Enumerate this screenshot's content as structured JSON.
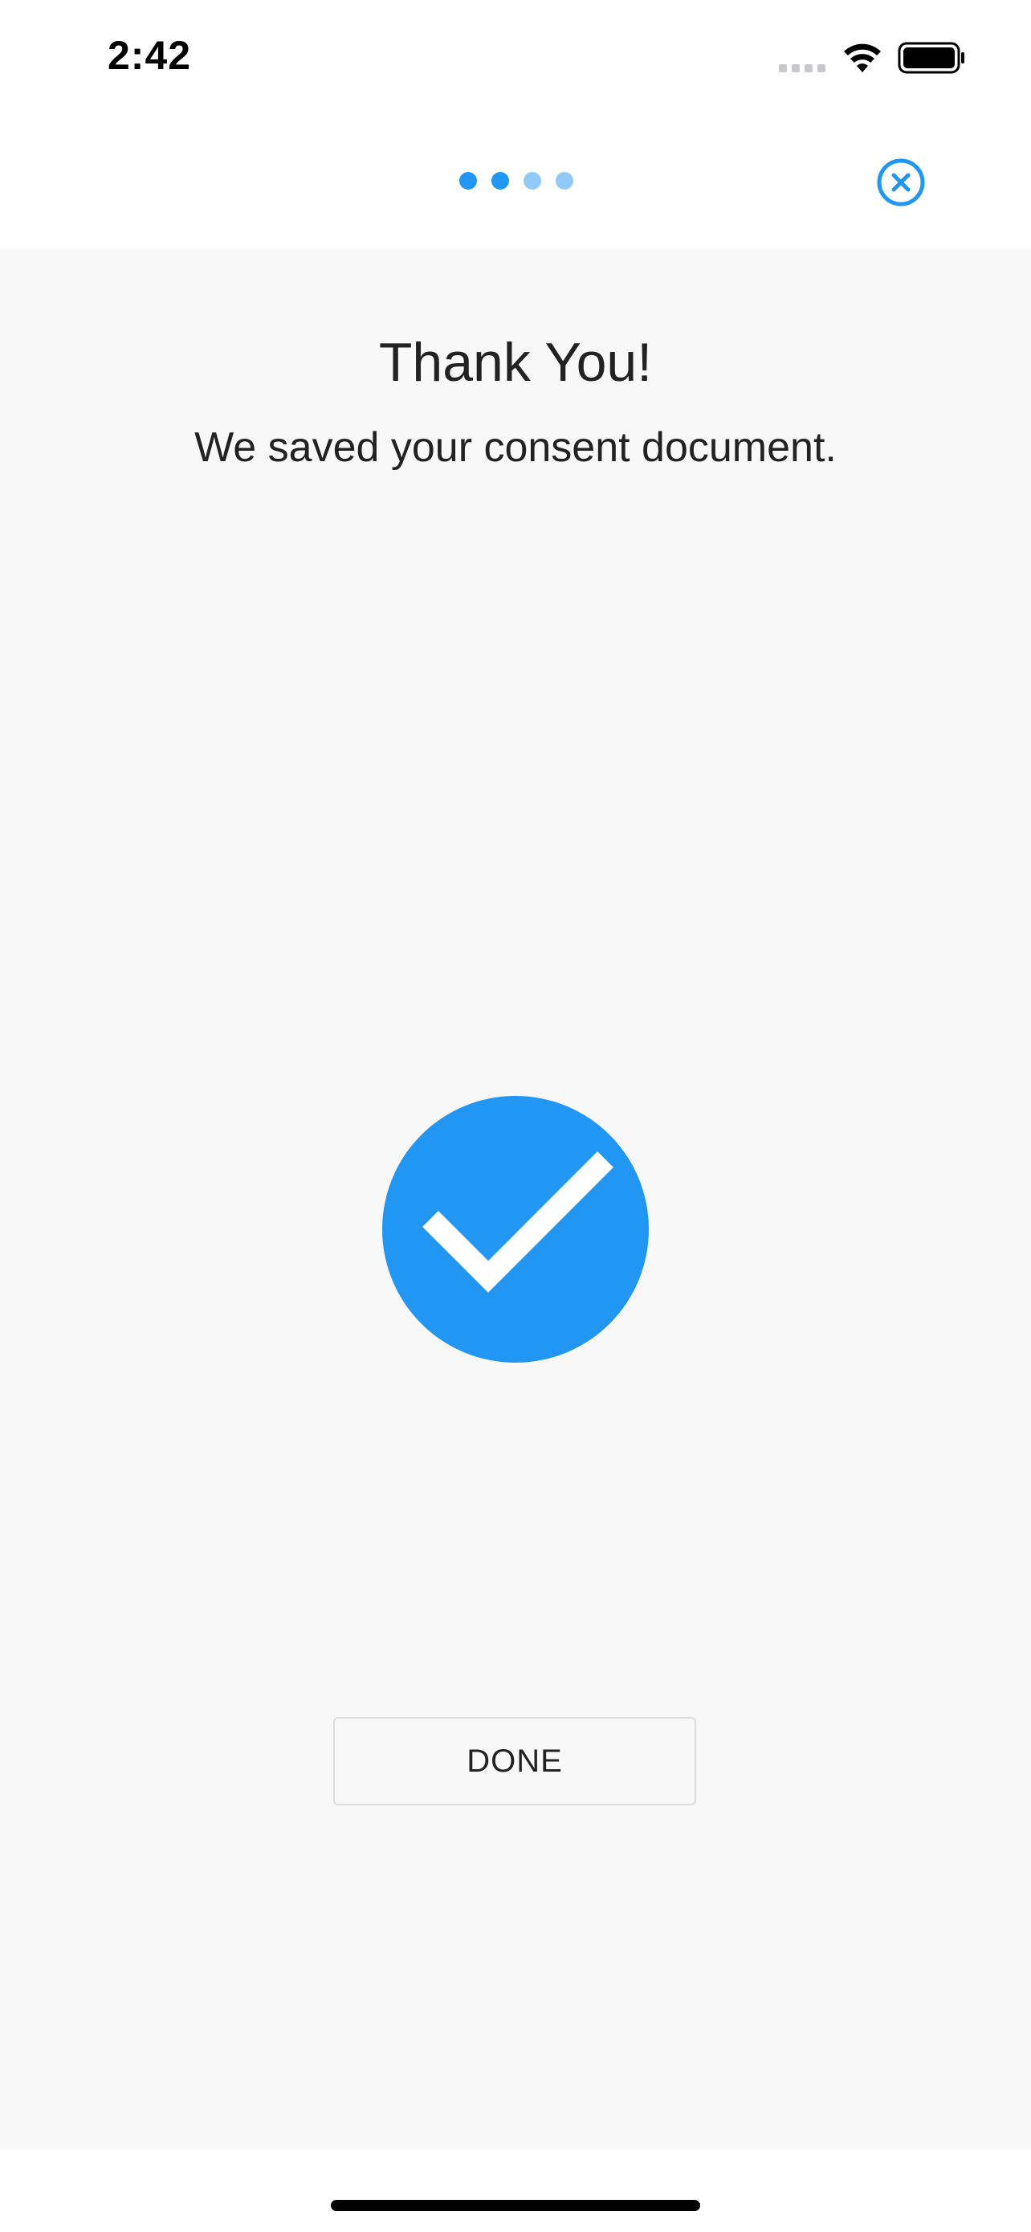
{
  "status_bar": {
    "time": "2:42"
  },
  "progress": {
    "total_steps": 4,
    "current_step": 2,
    "active_color": "#2196F3",
    "inactive_color": "#90CAF9"
  },
  "close_icon": "close-circle-icon",
  "content": {
    "title": "Thank You!",
    "message": "We saved your consent document.",
    "status_icon": "check-circle-icon",
    "accent_color": "#2196F3"
  },
  "actions": {
    "done_label": "DONE"
  }
}
